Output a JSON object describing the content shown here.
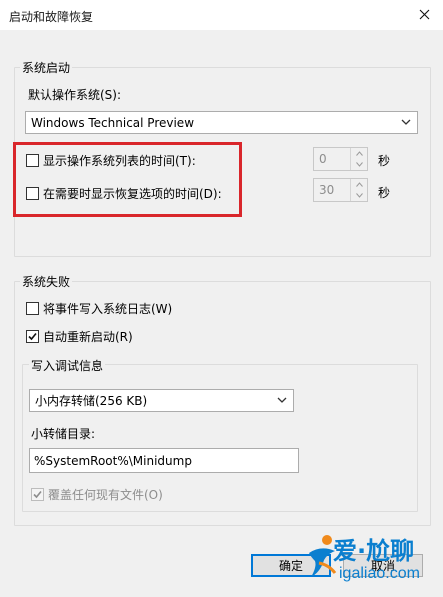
{
  "window": {
    "title": "启动和故障恢复",
    "close_icon": "close-icon"
  },
  "startup": {
    "group_label": "系统启动",
    "default_os_label": "默认操作系统(S):",
    "default_os_value": "Windows Technical Preview",
    "show_os_list": {
      "label": "显示操作系统列表的时间(T):",
      "checked": false,
      "value": "0",
      "unit": "秒"
    },
    "show_recovery": {
      "label": "在需要时显示恢复选项的时间(D):",
      "checked": false,
      "value": "30",
      "unit": "秒"
    },
    "highlight_color": "#d9262b"
  },
  "failure": {
    "group_label": "系统失败",
    "write_event_log": {
      "label": "将事件写入系统日志(W)",
      "checked": false
    },
    "auto_restart": {
      "label": "自动重新启动(R)",
      "checked": true
    },
    "debug": {
      "group_label": "写入调试信息",
      "dump_type": "小内存转储(256 KB)",
      "dump_dir_label": "小转储目录:",
      "dump_dir_value": "%SystemRoot%\\Minidump",
      "overwrite": {
        "label": "覆盖任何现有文件(O)",
        "checked": true,
        "disabled": true
      }
    }
  },
  "buttons": {
    "ok": "确定",
    "cancel": "取消"
  },
  "watermark": {
    "line1": "爱·尬聊",
    "line2": "igaliao.com"
  },
  "colors": {
    "accent": "#0078d7",
    "watermark": "#0b7fcf"
  }
}
